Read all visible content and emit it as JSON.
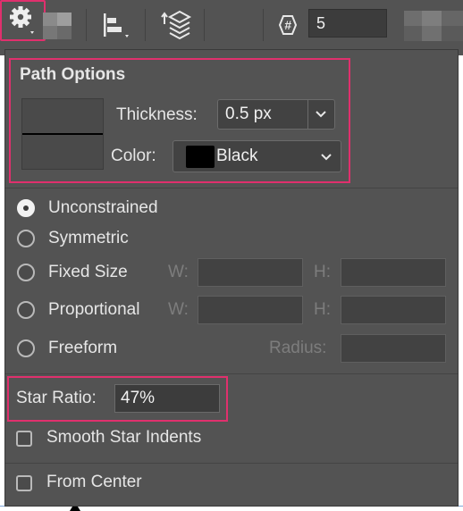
{
  "toolbar": {
    "sides_value": "5",
    "icons": [
      "align-icon",
      "arrange-layers-icon",
      "gear-icon",
      "hash-icon"
    ]
  },
  "path_options": {
    "title": "Path Options",
    "thickness_label": "Thickness:",
    "thickness_value": "0.5 px",
    "color_label": "Color:",
    "color_value": "Black",
    "color_swatch": "#000000"
  },
  "constraints": {
    "options": [
      {
        "label": "Unconstrained",
        "selected": true
      },
      {
        "label": "Symmetric",
        "selected": false
      },
      {
        "label": "Fixed Size",
        "selected": false
      },
      {
        "label": "Proportional",
        "selected": false
      },
      {
        "label": "Freeform",
        "selected": false
      }
    ],
    "w_label": "W:",
    "h_label": "H:",
    "radius_label": "Radius:"
  },
  "star": {
    "ratio_label": "Star Ratio:",
    "ratio_value": "47%",
    "smooth_label": "Smooth Star Indents"
  },
  "from_center_label": "From Center",
  "colors": {
    "highlight": "#e0306d",
    "panel": "#535353"
  }
}
